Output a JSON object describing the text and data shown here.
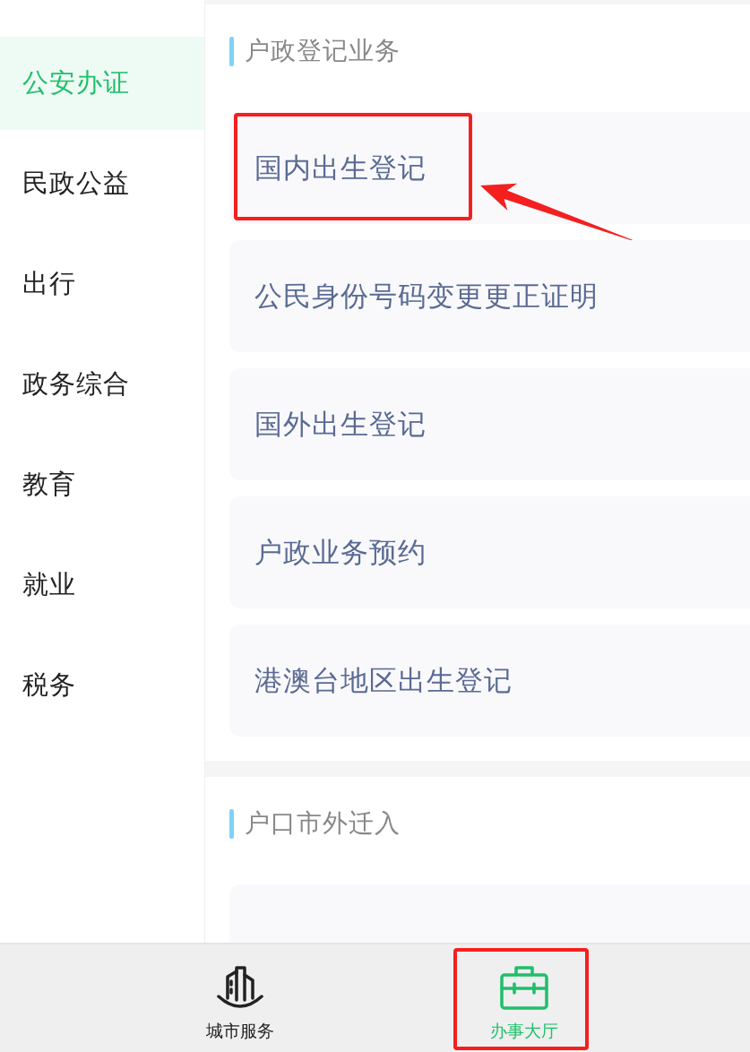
{
  "sidebar": {
    "items": [
      {
        "label": "公安办证",
        "selected": true
      },
      {
        "label": "民政公益",
        "selected": false
      },
      {
        "label": "出行",
        "selected": false
      },
      {
        "label": "政务综合",
        "selected": false
      },
      {
        "label": "教育",
        "selected": false
      },
      {
        "label": "就业",
        "selected": false
      },
      {
        "label": "税务",
        "selected": false
      }
    ]
  },
  "sections": [
    {
      "title": "户政登记业务",
      "items": [
        {
          "kind": "service",
          "label": "国内出生登记",
          "marked": true
        },
        {
          "kind": "service",
          "label": "公民身份号码变更更正证明",
          "marked": false
        },
        {
          "kind": "service",
          "label": "国外出生登记",
          "marked": false
        },
        {
          "kind": "service",
          "label": "户政业务预约",
          "marked": false
        },
        {
          "kind": "service",
          "label": "港澳台地区出生登记",
          "marked": false
        }
      ]
    },
    {
      "title": "户口市外迁入",
      "items": [
        {
          "kind": "cut_off"
        }
      ]
    }
  ],
  "tab_bar": [
    {
      "label": "城市服务",
      "selected": false,
      "marked": false
    },
    {
      "label": "办事大厅",
      "selected": true,
      "marked": true
    }
  ]
}
